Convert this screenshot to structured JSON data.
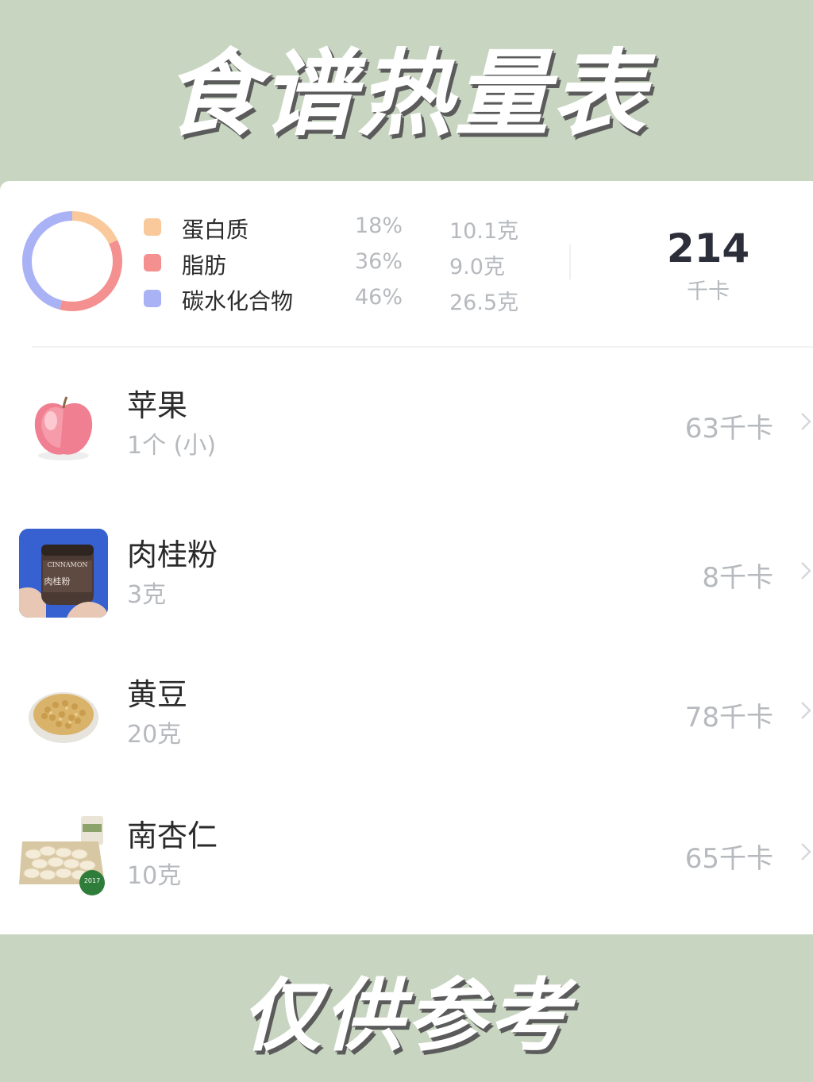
{
  "header": {
    "title": "食谱热量表"
  },
  "footer": {
    "note": "仅供参考"
  },
  "summary": {
    "macros": [
      {
        "name": "蛋白质",
        "percent": "18%",
        "grams": "10.1克",
        "color": "#f9c99b"
      },
      {
        "name": "脂肪",
        "percent": "36%",
        "grams": "9.0克",
        "color": "#f4908f"
      },
      {
        "name": "碳水化合物",
        "percent": "46%",
        "grams": "26.5克",
        "color": "#aab2f6"
      }
    ],
    "total": {
      "value": "214",
      "unit": "千卡"
    }
  },
  "foods": [
    {
      "name": "苹果",
      "portion": "1个 (小)",
      "calories": "63千卡",
      "icon": "apple-icon"
    },
    {
      "name": "肉桂粉",
      "portion": "3克",
      "calories": "8千卡",
      "icon": "cinnamon-jar-icon",
      "label": "CINNAMON",
      "label_cn": "肉桂粉"
    },
    {
      "name": "黄豆",
      "portion": "20克",
      "calories": "78千卡",
      "icon": "soybean-bowl-icon"
    },
    {
      "name": "南杏仁",
      "portion": "10克",
      "calories": "65千卡",
      "icon": "almond-tray-icon",
      "badge": "2017"
    }
  ]
}
